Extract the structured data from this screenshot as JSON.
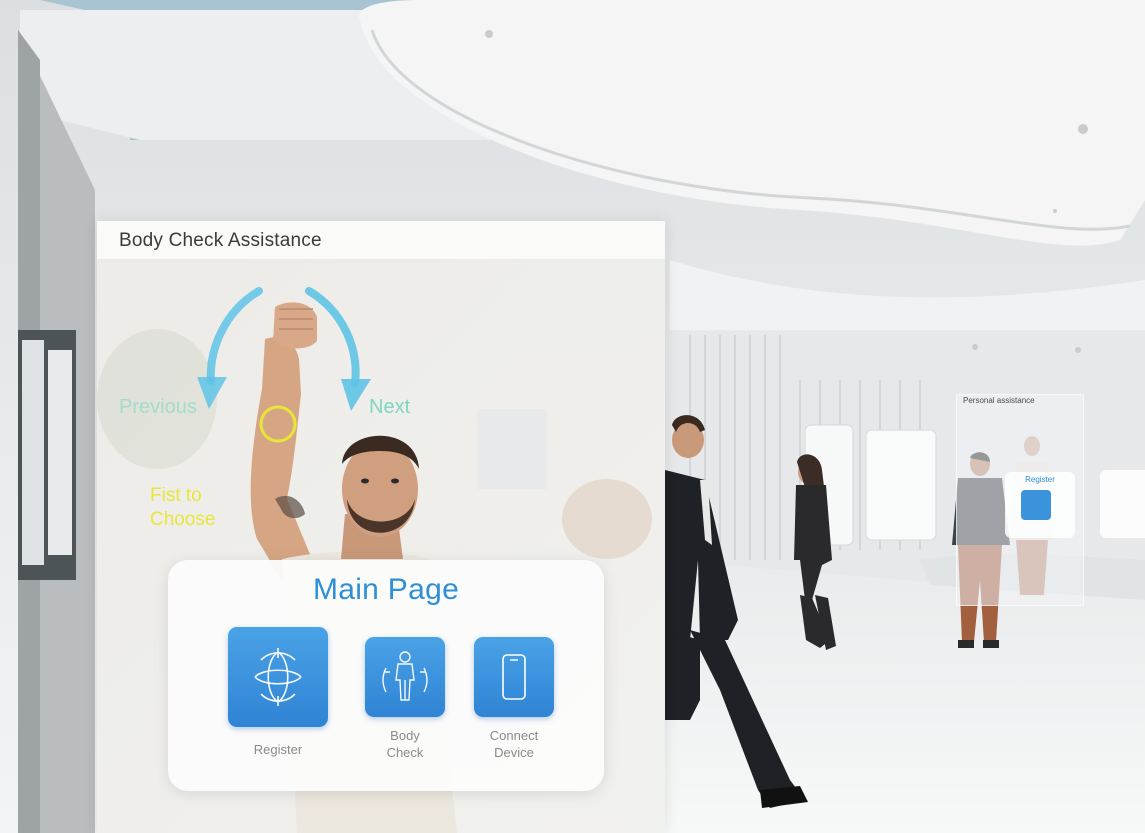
{
  "panel": {
    "title": "Body Check Assistance",
    "gesture": {
      "previous_label": "Previous",
      "next_label": "Next",
      "fist_label": "Fist to Choose"
    },
    "main": {
      "title": "Main Page",
      "items": [
        {
          "label": "Register",
          "icon": "globe-target-icon"
        },
        {
          "label": "Body Check",
          "icon": "body-scan-icon"
        },
        {
          "label": "Connect Device",
          "icon": "smartphone-icon"
        }
      ]
    }
  },
  "far_panel": {
    "title": "Personal assistance",
    "card_title": "Register"
  },
  "colors": {
    "accent_blue": "#2f8fd6",
    "tile_blue": "#3a8fdd",
    "arrow_cyan": "#5ec3e6",
    "next_teal": "#7fd6c2",
    "fist_yellow": "#e8e63a"
  }
}
